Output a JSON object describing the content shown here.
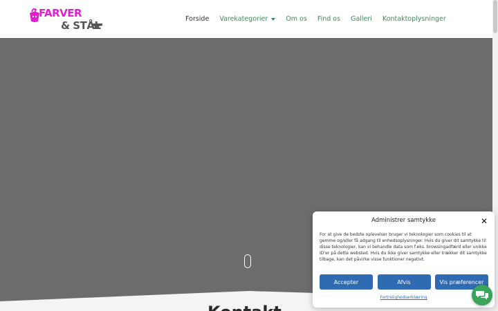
{
  "header": {
    "logo": {
      "line1": "FARVER",
      "line2": "& STÅL"
    },
    "nav": [
      {
        "label": "Forside",
        "active": true
      },
      {
        "label": "Varekategorier",
        "has_dropdown": true
      },
      {
        "label": "Om os"
      },
      {
        "label": "Find os"
      },
      {
        "label": "Galleri"
      },
      {
        "label": "Kontaktoplysninger"
      }
    ]
  },
  "main": {
    "heading_peek": "Kontakt"
  },
  "consent": {
    "title": "Administrer samtykke",
    "body": "For at give de bedste oplevelser bruger vi teknologier som cookies til at gemme og/eller få adgang til enhedsoplysninger. Hvis du giver dit samtykke til disse teknologier, kan vi behandle data som f.eks. browsingadfærd eller unikke ID'er på dette websted. Hvis du ikke giver samtykke eller trækker dit samtykke tilbage, kan det påvirke visse funktioner negativt.",
    "buttons": {
      "accept": "Accepter",
      "deny": "Afvis",
      "preferences": "Vis præferencer"
    },
    "policy_link": "Fortrolighedserklæring"
  },
  "icons": {
    "close": "close-icon",
    "chat": "chat-icon",
    "scroll": "scroll-mouse-icon"
  },
  "colors": {
    "nav_link": "#3f8a55",
    "hero_bg": "#6c6c6c",
    "button": "#2f6bb3",
    "chat": "#3aa55a",
    "logo_pink": "#e020d0"
  }
}
